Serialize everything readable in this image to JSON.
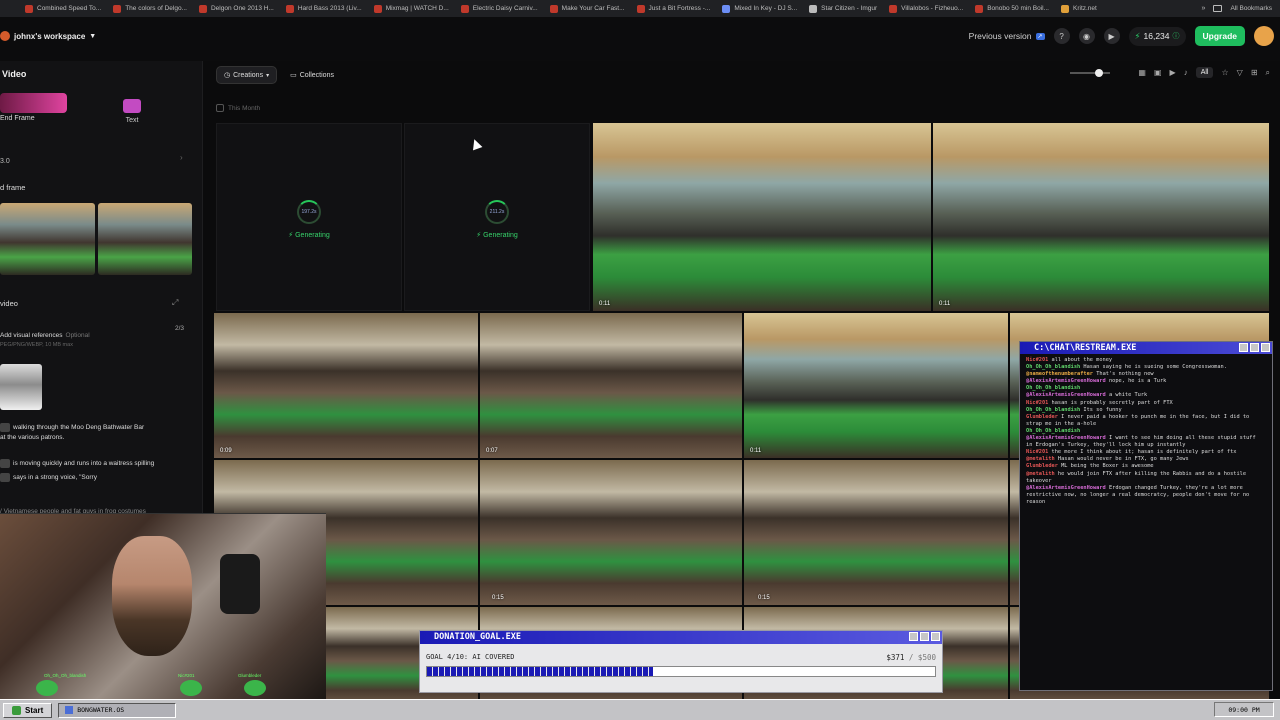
{
  "bookmarks": [
    {
      "label": "Combined Speed To...",
      "color": "r"
    },
    {
      "label": "The colors of Delgo...",
      "color": "r"
    },
    {
      "label": "Delgon One 2013 H...",
      "color": "r"
    },
    {
      "label": "Hard Bass 2013 (Liv...",
      "color": "r"
    },
    {
      "label": "Mixmag | WATCH D...",
      "color": "r"
    },
    {
      "label": "Electric Daisy Carniv...",
      "color": "r"
    },
    {
      "label": "Make Your Car Fast...",
      "color": "r"
    },
    {
      "label": "Just a Bit Fortress -...",
      "color": "r"
    },
    {
      "label": "Mixed In Key - DJ S...",
      "color": "b"
    },
    {
      "label": "Star Citizen - Imgur",
      "color": "g"
    },
    {
      "label": "Villalobos - Fizheuo...",
      "color": "r"
    },
    {
      "label": "Bonobo 50 min Boil...",
      "color": "r"
    },
    {
      "label": "Kritz.net",
      "color": "y"
    }
  ],
  "bookmarks_right": "All Bookmarks",
  "workspace": "johnx's workspace",
  "topbar": {
    "previous_version": "Previous version",
    "credits": "16,234",
    "upgrade": "Upgrade"
  },
  "sidebar": {
    "title": "Video",
    "frame_tab": "End Frame",
    "text_tab": "Text",
    "model": "3.0",
    "frame_label": "d frame",
    "video_label": "video",
    "visual_refs": "Add visual references",
    "optional": "Optional",
    "formats": "PEG/PNG/WEBP, 10 MB max",
    "ref_count": "2/3",
    "prompt_lines": [
      "walking through the Moo Deng Bathwater Bar",
      "at the various patrons.",
      "is moving quickly and runs into a waitress spilling",
      "says in a strong voice, \"Sorry",
      "/ Vietnamese people and fat guys in frog costumes"
    ]
  },
  "main": {
    "filter_creations": "Creations",
    "filter_collections": "Collections",
    "this_month": "This Month",
    "all": "All",
    "generating": [
      {
        "pct": "197.2s",
        "label": "Generating"
      },
      {
        "pct": "211.2s",
        "label": "Generating"
      }
    ],
    "durations": {
      "a": "0:11",
      "b": "0:11",
      "c": "0:09",
      "d": "0:07",
      "e": "0:11",
      "f": "0:15",
      "g": "0:15"
    }
  },
  "chat": {
    "title": "C:\\CHAT\\RESTREAM.EXE",
    "messages": [
      {
        "user": "Nic#201",
        "text": "all about the money",
        "c": ""
      },
      {
        "user": "Oh_Oh_Oh_blandish",
        "text": "Hasan saying he is sueing some Congresswoman.",
        "c": "g"
      },
      {
        "user": "@nameofthenumberafter",
        "text": "That's nothing new",
        "c": "o"
      },
      {
        "user": "@AlexisArtemisGreenHoward",
        "text": "nope, he is a Turk",
        "c": "p"
      },
      {
        "user": "Oh_Oh_Oh_blandish",
        "text": "",
        "c": "g"
      },
      {
        "user": "@AlexisArtemisGreenHoward",
        "text": "a white Turk",
        "c": "p"
      },
      {
        "user": "Nic#201",
        "text": "hasan is probably secretly part of FTX",
        "c": ""
      },
      {
        "user": "Oh_Oh_Oh_blandish",
        "text": "Its so funny",
        "c": "g"
      },
      {
        "user": "Glumbleder",
        "text": "I never paid a hooker to punch me in the face, but I did to strap me in the a-hole",
        "c": ""
      },
      {
        "user": "Oh_Oh_Oh_blandish",
        "text": "",
        "c": "g"
      },
      {
        "user": "@AlexisArtemisGreenHoward",
        "text": "I want to see him doing all these stupid stuff in Erdogan's Turkey, they'll lock him up instantly",
        "c": "p"
      },
      {
        "user": "Nic#201",
        "text": "the more I think about it; hasan is definitely part of ftx",
        "c": ""
      },
      {
        "user": "@metalith",
        "text": "Hasan would never be in FTX, go many Jews",
        "c": ""
      },
      {
        "user": "Glumbleder",
        "text": "ML being the Boxer is awesome",
        "c": ""
      },
      {
        "user": "@metalith",
        "text": "he would join FTX after killing the Rabbis and do a hostile takeover",
        "c": ""
      },
      {
        "user": "@AlexisArtemisGreenHoward",
        "text": "Erdogan changed Turkey, they're a lot more restrictive now, no longer a real democratcy, people don't move for no reason",
        "c": "p"
      }
    ]
  },
  "donation": {
    "title": "DONATION_GOAL.EXE",
    "goal": "GOAL 4/10: AI COVERED",
    "raised": "$371",
    "target": "/ $500",
    "progress": 0.742
  },
  "webcam": {
    "labels": [
      "Oh_Oh_Oh_blandish",
      "Nic#201",
      "Glumbleder"
    ]
  },
  "taskbar": {
    "start": "Start",
    "item": "BONGWATER.OS",
    "clock": "09:00 PM"
  }
}
